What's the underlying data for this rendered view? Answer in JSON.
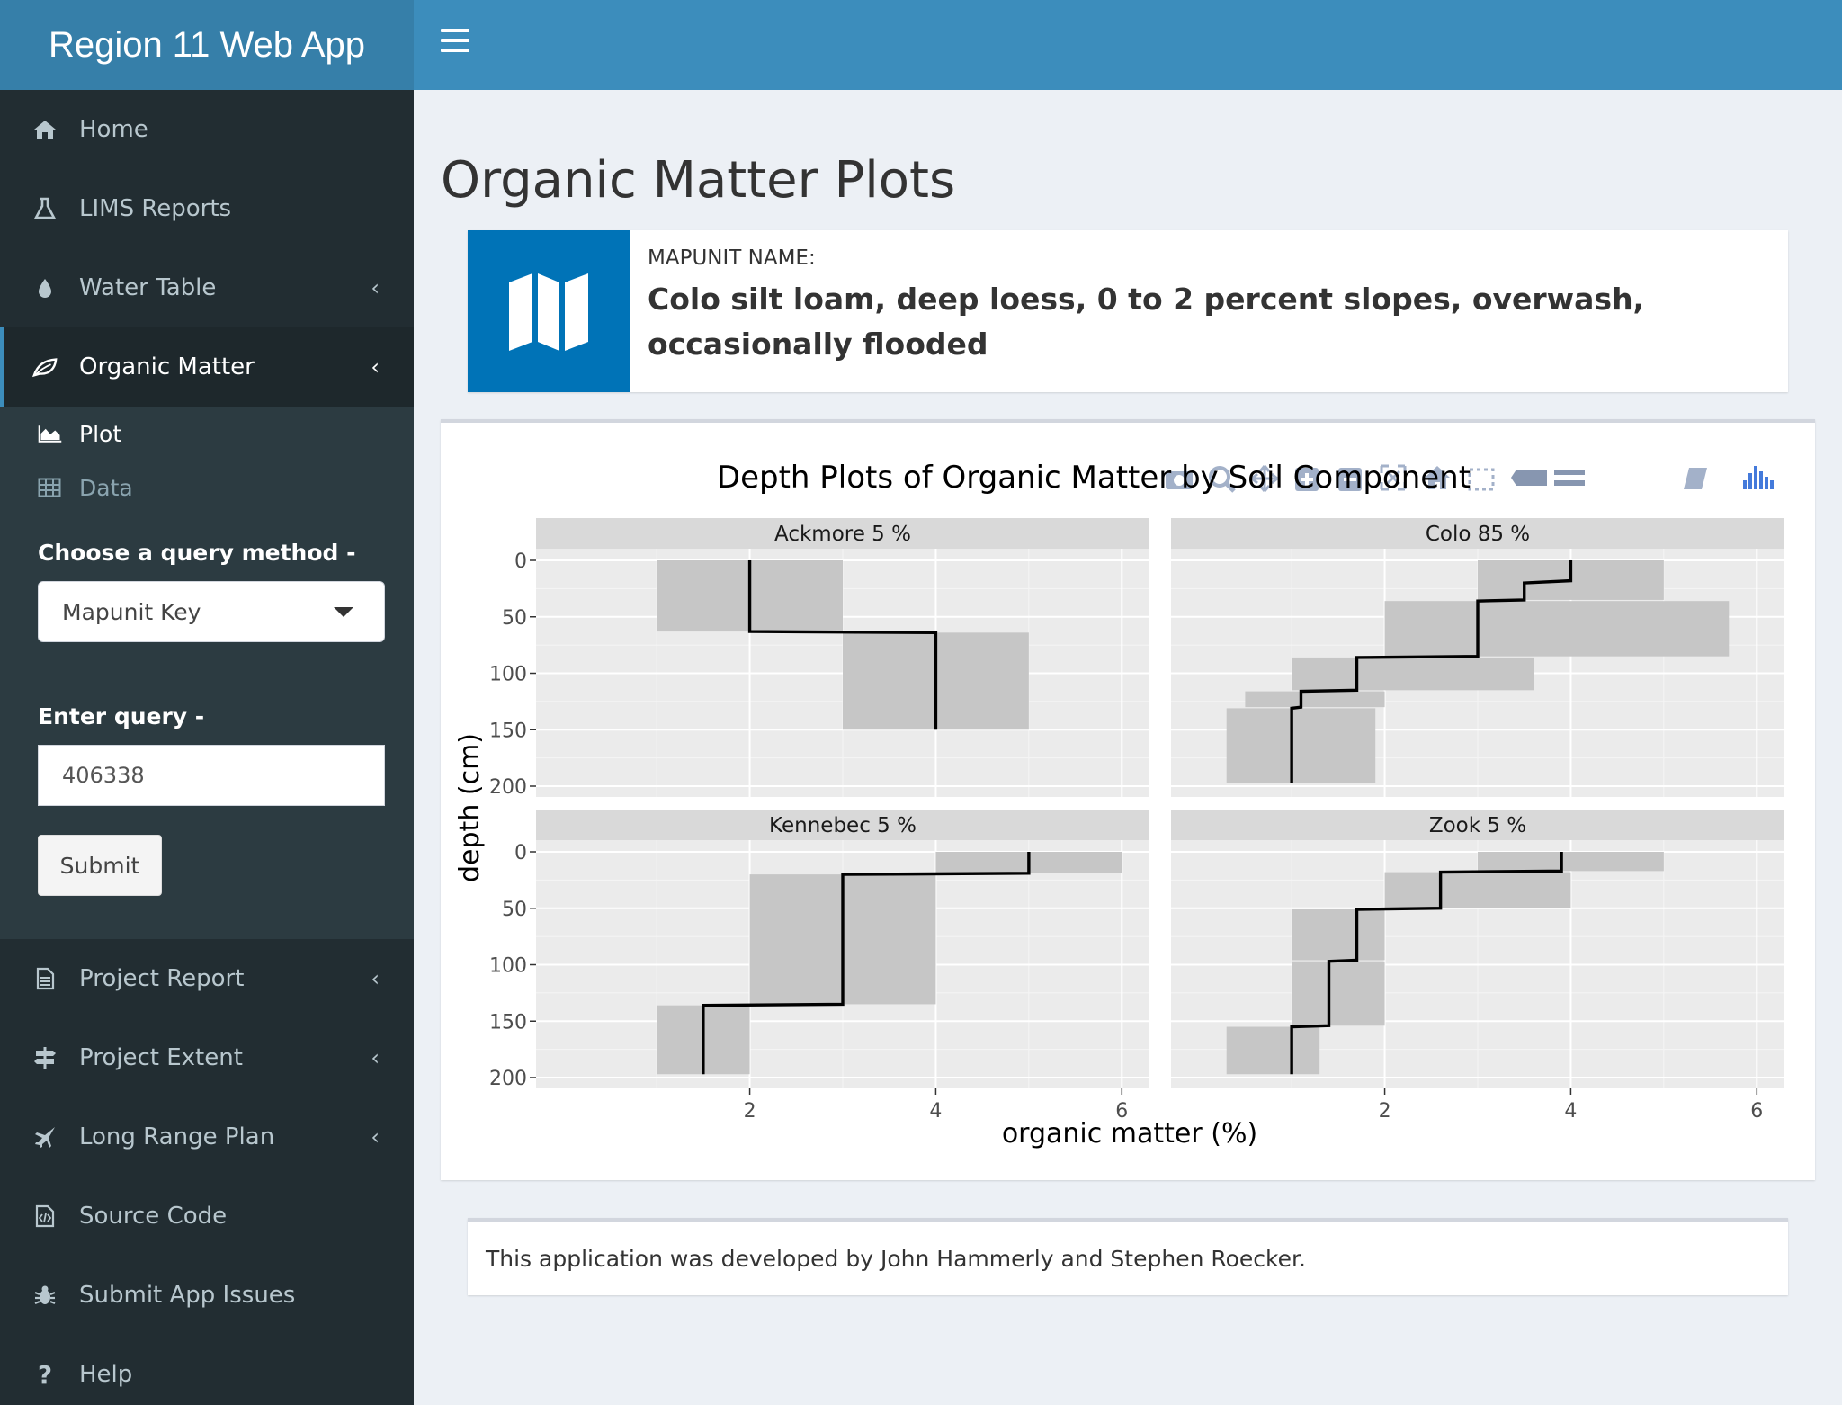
{
  "app": {
    "title": "Region 11 Web App"
  },
  "sidebar": {
    "items": [
      {
        "label": "Home",
        "icon": "home-icon"
      },
      {
        "label": "LIMS Reports",
        "icon": "flask-icon"
      },
      {
        "label": "Water Table",
        "icon": "tint-icon"
      },
      {
        "label": "Organic Matter",
        "icon": "leaf-icon"
      },
      {
        "label": "Project Report",
        "icon": "file-text-icon"
      },
      {
        "label": "Project Extent",
        "icon": "signpost-icon"
      },
      {
        "label": "Long Range Plan",
        "icon": "plane-icon"
      },
      {
        "label": "Source Code",
        "icon": "code-file-icon"
      },
      {
        "label": "Submit App Issues",
        "icon": "bug-icon"
      },
      {
        "label": "Help",
        "icon": "question-icon"
      }
    ],
    "sub_items": [
      {
        "label": "Plot",
        "icon": "area-chart-icon"
      },
      {
        "label": "Data",
        "icon": "table-icon"
      }
    ],
    "query_method_label": "Choose a query method -",
    "query_method_value": "Mapunit Key",
    "query_label": "Enter query -",
    "query_value": "406338",
    "submit_label": "Submit"
  },
  "main": {
    "title": "Organic Matter Plots",
    "info_label": "MAPUNIT NAME:",
    "info_value": "Colo silt loam, deep loess, 0 to 2 percent slopes, overwash, occasionally flooded",
    "footer": "This application was developed by John Hammerly and Stephen Roecker."
  },
  "chart_data": {
    "type": "line",
    "title": "Depth Plots of Organic Matter by Soil Component",
    "xlabel": "organic matter (%)",
    "ylabel": "depth (cm)",
    "xlim": [
      0,
      6
    ],
    "ylim": [
      200,
      0
    ],
    "x_ticks": [
      2,
      4,
      6
    ],
    "y_ticks": [
      0,
      50,
      100,
      150,
      200
    ],
    "grid": true,
    "panels": [
      {
        "name": "Ackmore 5 %",
        "line": [
          [
            2,
            0
          ],
          [
            2,
            63
          ],
          [
            4,
            64
          ],
          [
            4,
            150
          ]
        ],
        "bands": [
          {
            "top": 0,
            "bottom": 63,
            "xmin": 1,
            "xmax": 3
          },
          {
            "top": 64,
            "bottom": 150,
            "xmin": 3,
            "xmax": 5
          }
        ]
      },
      {
        "name": "Colo 85 %",
        "line": [
          [
            4,
            0
          ],
          [
            4,
            18
          ],
          [
            3.5,
            20
          ],
          [
            3.5,
            35
          ],
          [
            3,
            36
          ],
          [
            3,
            85
          ],
          [
            1.7,
            86
          ],
          [
            1.7,
            115
          ],
          [
            1.1,
            116
          ],
          [
            1.1,
            130
          ],
          [
            1,
            131
          ],
          [
            1,
            197
          ]
        ],
        "bands": [
          {
            "top": 0,
            "bottom": 35,
            "xmin": 3,
            "xmax": 5
          },
          {
            "top": 36,
            "bottom": 85,
            "xmin": 2,
            "xmax": 5.7
          },
          {
            "top": 86,
            "bottom": 115,
            "xmin": 1,
            "xmax": 3.6
          },
          {
            "top": 116,
            "bottom": 130,
            "xmin": 0.5,
            "xmax": 2
          },
          {
            "top": 131,
            "bottom": 197,
            "xmin": 0.3,
            "xmax": 1.9
          }
        ]
      },
      {
        "name": "Kennebec 5 %",
        "line": [
          [
            5,
            0
          ],
          [
            5,
            19
          ],
          [
            3,
            20
          ],
          [
            3,
            135
          ],
          [
            1.5,
            136
          ],
          [
            1.5,
            197
          ]
        ],
        "bands": [
          {
            "top": 0,
            "bottom": 19,
            "xmin": 4,
            "xmax": 6
          },
          {
            "top": 20,
            "bottom": 135,
            "xmin": 2,
            "xmax": 4
          },
          {
            "top": 136,
            "bottom": 197,
            "xmin": 1,
            "xmax": 2
          }
        ]
      },
      {
        "name": "Zook 5 %",
        "line": [
          [
            3.9,
            0
          ],
          [
            3.9,
            17
          ],
          [
            2.6,
            18
          ],
          [
            2.6,
            50
          ],
          [
            1.7,
            51
          ],
          [
            1.7,
            96
          ],
          [
            1.4,
            97
          ],
          [
            1.4,
            154
          ],
          [
            1,
            155
          ],
          [
            1,
            197
          ]
        ],
        "bands": [
          {
            "top": 0,
            "bottom": 17,
            "xmin": 3,
            "xmax": 5
          },
          {
            "top": 18,
            "bottom": 50,
            "xmin": 2,
            "xmax": 4
          },
          {
            "top": 51,
            "bottom": 96,
            "xmin": 1,
            "xmax": 2
          },
          {
            "top": 97,
            "bottom": 154,
            "xmin": 1,
            "xmax": 2
          },
          {
            "top": 155,
            "bottom": 197,
            "xmin": 0.3,
            "xmax": 1.3
          }
        ]
      }
    ]
  },
  "toolbar": {
    "icons": [
      "camera-icon",
      "zoom-icon",
      "pan-icon",
      "zoom-in-icon",
      "zoom-out-icon",
      "autoscale-icon",
      "reset-axes-icon",
      "select-icon",
      "hover-closest-icon",
      "hover-compare-icon",
      "edit-plot-icon",
      "plotly-logo-icon"
    ]
  },
  "colors": {
    "header": "#3c8dbc",
    "brand": "#367fa9",
    "sidebar": "#222d32",
    "sidebar_sub": "#2c3b41",
    "info_icon": "#0073b7",
    "panel_bg": "#ebebeb",
    "strip_bg": "#d9d9d9",
    "band": "#c6c6c6"
  }
}
